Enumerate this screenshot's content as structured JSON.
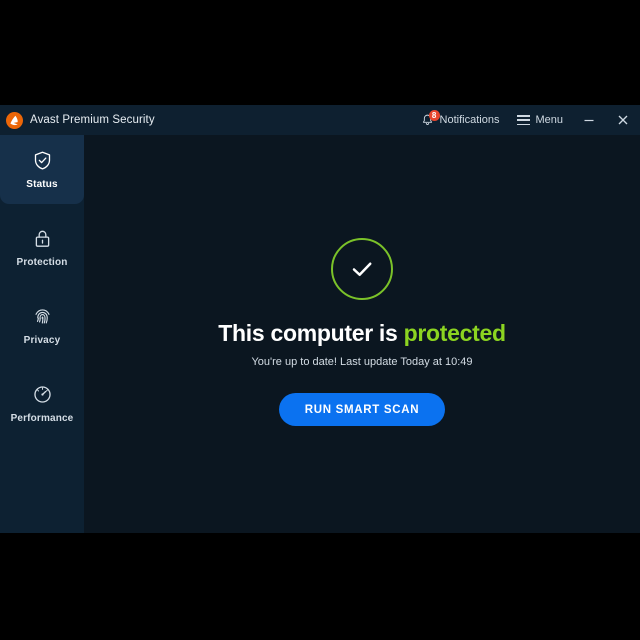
{
  "window": {
    "brand_title": "Avast Premium Security",
    "logo_icon": "avast-logo-icon"
  },
  "titlebar": {
    "notifications": {
      "label": "Notifications",
      "icon": "bell-icon",
      "badge_count": "8"
    },
    "menu": {
      "label": "Menu",
      "icon": "hamburger-icon"
    },
    "minimize": {
      "label": "—",
      "icon": "minimize-icon"
    },
    "close": {
      "label": "✕",
      "icon": "close-icon"
    }
  },
  "sidebar": {
    "items": [
      {
        "label": "Status",
        "icon": "shield-check-icon",
        "active": true
      },
      {
        "label": "Protection",
        "icon": "lock-icon",
        "active": false
      },
      {
        "label": "Privacy",
        "icon": "fingerprint-icon",
        "active": false
      },
      {
        "label": "Performance",
        "icon": "gauge-icon",
        "active": false
      }
    ]
  },
  "main": {
    "status_icon": "check-circle-icon",
    "heading_prefix": "This computer is ",
    "heading_accent": "protected",
    "subtitle": "You're up to date! Last update Today at 10:49",
    "scan_button_label": "RUN SMART SCAN"
  },
  "colors": {
    "accent_green": "#8cd421",
    "button_blue": "#0b72f0",
    "badge_red": "#e8452c",
    "brand_orange": "#ec6608",
    "window_bg": "#0b1620",
    "titlebar_bg": "#0e2030",
    "sidebar_bg": "#0d2132",
    "sidebar_active_bg": "#16304a"
  }
}
